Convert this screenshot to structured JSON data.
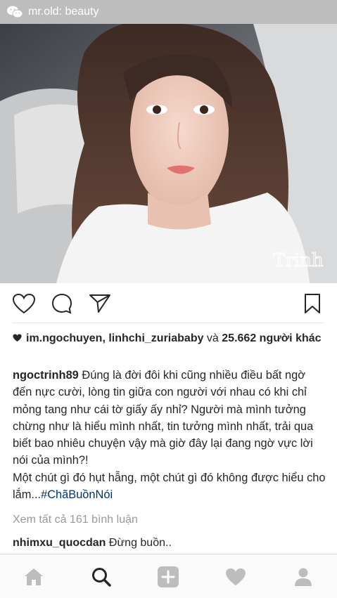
{
  "watermark": {
    "text": "mr.old: beauty",
    "icon": "wechat-icon"
  },
  "photo": {
    "overlay_text": "Trinh",
    "description_icon": "photo"
  },
  "actions": {
    "like_icon": "heart-outline-icon",
    "comment_icon": "speech-bubble-icon",
    "share_icon": "paper-plane-icon",
    "save_icon": "bookmark-icon"
  },
  "likes": {
    "names": "im.ngochuyen, linhchi_zuriababy",
    "connector": " và ",
    "count_text": "25.662 người khác"
  },
  "caption": {
    "username": "ngoctrinh89",
    "text_line1": " Đúng là đời đôi khi cũng nhiều điều bất ngờ đến nực cười, lòng tin giữa con người với nhau có khi chỉ mỏng tang như cái tờ giấy ấy nhỉ? Người mà mình tưởng chừng như là hiểu mình nhất, tin tưởng mình nhất, trải qua biết bao nhiêu chuyện vậy mà giờ đây lại đang ngờ vực lời nói của mình?!",
    "text_line2": "Một chút gì đó hụt hẫng, một chút gì đó không được hiểu cho lắm...",
    "hashtag": "#ChãBuồnNói"
  },
  "view_all_comments": "Xem tất cả 161 bình luận",
  "comment": {
    "username": "nhimxu_quocdan",
    "text": " Đừng buồn.."
  },
  "tabbar": {
    "items": [
      "home-icon",
      "search-icon",
      "add-post-icon",
      "activity-heart-icon",
      "profile-icon"
    ],
    "active_color": "#262626",
    "inactive_color": "#bdbdbd"
  }
}
